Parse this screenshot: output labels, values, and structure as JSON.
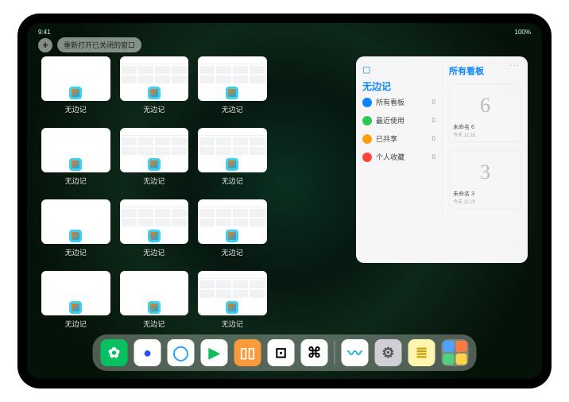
{
  "status": {
    "left": "9:41",
    "right": "100%"
  },
  "pill": {
    "add": "+",
    "label": "重新打开已关闭的窗口"
  },
  "windows": [
    {
      "label": "无边记",
      "kind": "blank"
    },
    {
      "label": "无边记",
      "kind": "grid"
    },
    {
      "label": "无边记",
      "kind": "grid"
    },
    null,
    {
      "label": "无边记",
      "kind": "blank"
    },
    {
      "label": "无边记",
      "kind": "grid"
    },
    {
      "label": "无边记",
      "kind": "grid"
    },
    null,
    {
      "label": "无边记",
      "kind": "blank"
    },
    {
      "label": "无边记",
      "kind": "grid"
    },
    {
      "label": "无边记",
      "kind": "grid"
    },
    null,
    {
      "label": "无边记",
      "kind": "blank"
    },
    {
      "label": "无边记",
      "kind": "blank"
    },
    {
      "label": "无边记",
      "kind": "grid"
    }
  ],
  "panel": {
    "more": "···",
    "sidebar_title": "无边记",
    "menu": [
      {
        "label": "所有看板",
        "count": "0",
        "color": "#0a84ff"
      },
      {
        "label": "最近使用",
        "count": "0",
        "color": "#30c759"
      },
      {
        "label": "已共享",
        "count": "0",
        "color": "#ff9f0a"
      },
      {
        "label": "个人收藏",
        "count": "0",
        "color": "#ff453a"
      }
    ],
    "content_title": "所有看板",
    "boards": [
      {
        "doodle": "6",
        "name": "未命名 6",
        "sub": "今天 11:20"
      },
      {
        "doodle": "3",
        "name": "未命名 3",
        "sub": "今天 11:20"
      }
    ]
  },
  "dock": {
    "apps": [
      {
        "name": "wechat",
        "bg": "#07c160",
        "glyph": "✿",
        "fg": "#fff"
      },
      {
        "name": "tencent",
        "bg": "#ffffff",
        "glyph": "●",
        "fg": "#2a4dff"
      },
      {
        "name": "quark",
        "bg": "#ffffff",
        "glyph": "◯",
        "fg": "#1aa0ff"
      },
      {
        "name": "iqiyi",
        "bg": "#ffffff",
        "glyph": "▶",
        "fg": "#0cbf5a"
      },
      {
        "name": "books",
        "bg": "#fa9a3a",
        "glyph": "▯▯",
        "fg": "#fff"
      },
      {
        "name": "dice",
        "bg": "#ffffff",
        "glyph": "⊡",
        "fg": "#000"
      },
      {
        "name": "nodes",
        "bg": "#ffffff",
        "glyph": "⌘",
        "fg": "#000"
      }
    ],
    "recent": [
      {
        "name": "freeform",
        "bg": "#ffffff",
        "glyph": "〰",
        "fg": "#19b3cf"
      },
      {
        "name": "settings",
        "bg": "#d0d0d4",
        "glyph": "⚙",
        "fg": "#555"
      },
      {
        "name": "notes",
        "bg": "#fff6b0",
        "glyph": "≣",
        "fg": "#c8a000"
      }
    ],
    "library_colors": [
      "#4fa3ff",
      "#ff7a3d",
      "#4fd37a",
      "#ffd24a"
    ]
  }
}
